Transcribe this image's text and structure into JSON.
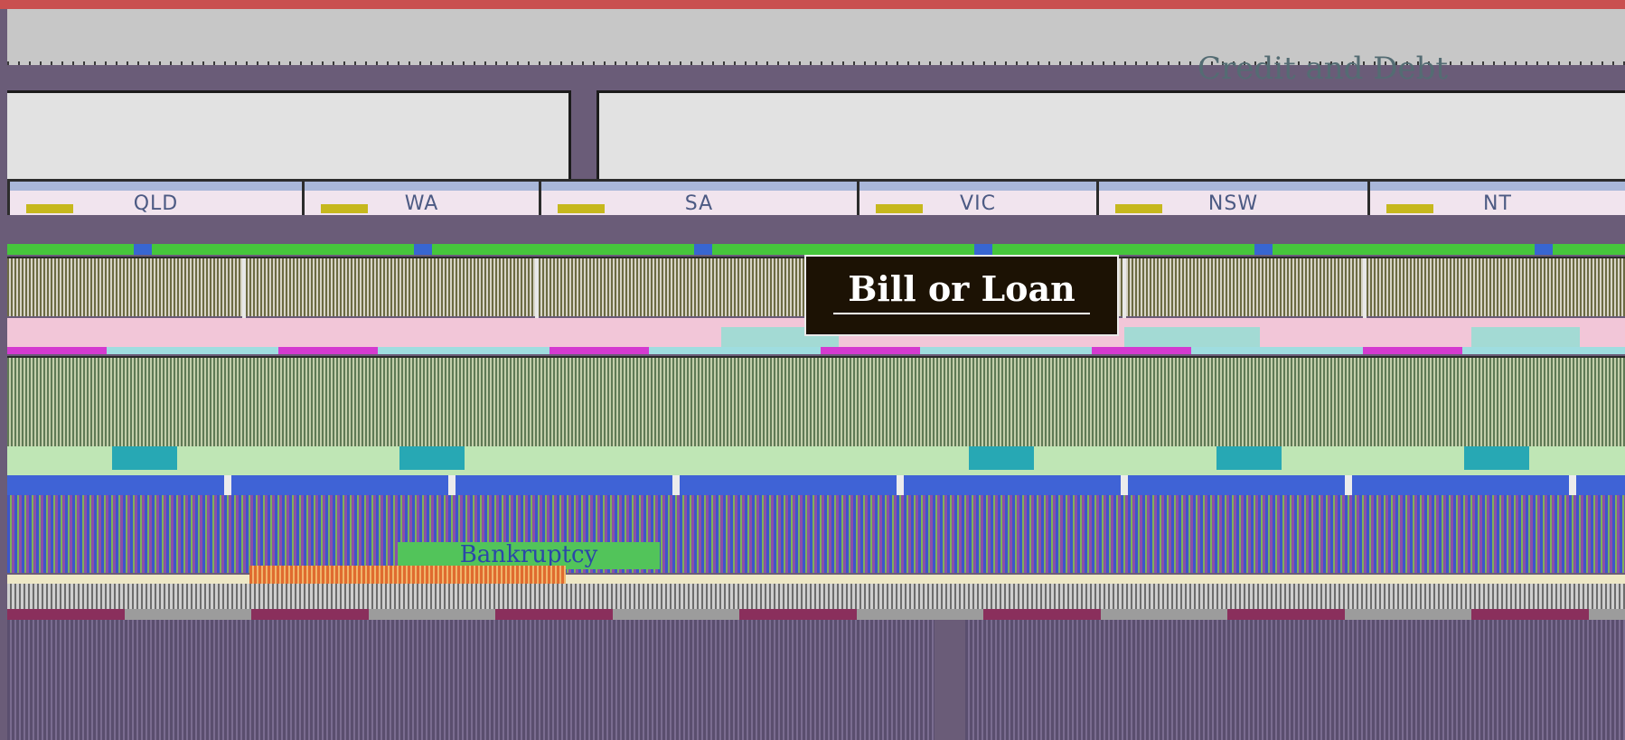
{
  "header": {
    "title": "Credit and Debt"
  },
  "regions": [
    {
      "label": "QLD",
      "width": 326
    },
    {
      "label": "WA",
      "width": 262
    },
    {
      "label": "SA",
      "width": 352
    },
    {
      "label": "VIC",
      "width": 265
    },
    {
      "label": "NSW",
      "width": 300
    },
    {
      "label": "NT",
      "width": 285
    }
  ],
  "badge": {
    "title": "Bill or Loan"
  },
  "bank_label": "Bankruptcy"
}
